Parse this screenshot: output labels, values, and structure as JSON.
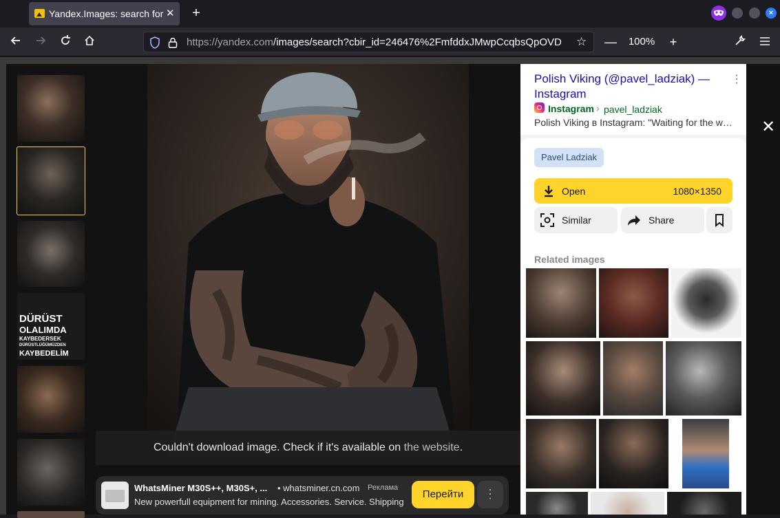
{
  "browser": {
    "tab_title": "Yandex.Images: search for",
    "url_host": "https://yandex.com",
    "url_path": "/images/search?cbir_id=246476%2FmfddxJMwpCcqbsQpOVD",
    "zoom": "100%",
    "icons": [
      "back-icon",
      "forward-icon",
      "reload-icon",
      "home-icon",
      "shield-icon",
      "lock-icon",
      "star-icon",
      "wrench-icon",
      "hamburger-menu-icon",
      "private-mask-icon"
    ]
  },
  "viewer": {
    "error_text": "Couldn't download image. Check if it's available on",
    "error_link": "the website",
    "error_suffix": ".",
    "thumb_text_lines": [
      "DÜRÜST",
      "OLALIMDA",
      "KAYBEDERSEK",
      "DÜRÜSTLÜĞÜMÜZDEN",
      "KAYBEDELİM"
    ]
  },
  "ad": {
    "title": "WhatsMiner M30S++, M30S+, ...",
    "domain": "• whatsminer.cn.com",
    "badge": "Реклама",
    "description": "New powerfull equipment for mining. Accessories. Service. Shipping",
    "button": "Перейти"
  },
  "panel": {
    "source_title": "Polish Viking (@pavel_ladziak) — Instagram",
    "site": "Instagram",
    "separator": "›",
    "username": "pavel_ladziak",
    "snippet": "Polish Viking в Instagram: \"Waiting for the weekend\"",
    "tag": "Pavel Ladziak",
    "open_label": "Open",
    "open_size": "1080×1350",
    "similar_label": "Similar",
    "share_label": "Share",
    "related_title": "Related images"
  },
  "colors": {
    "accent": "#fed42b",
    "link": "#1a0dab",
    "site_green": "#006621",
    "selection": "#f5d23a"
  }
}
